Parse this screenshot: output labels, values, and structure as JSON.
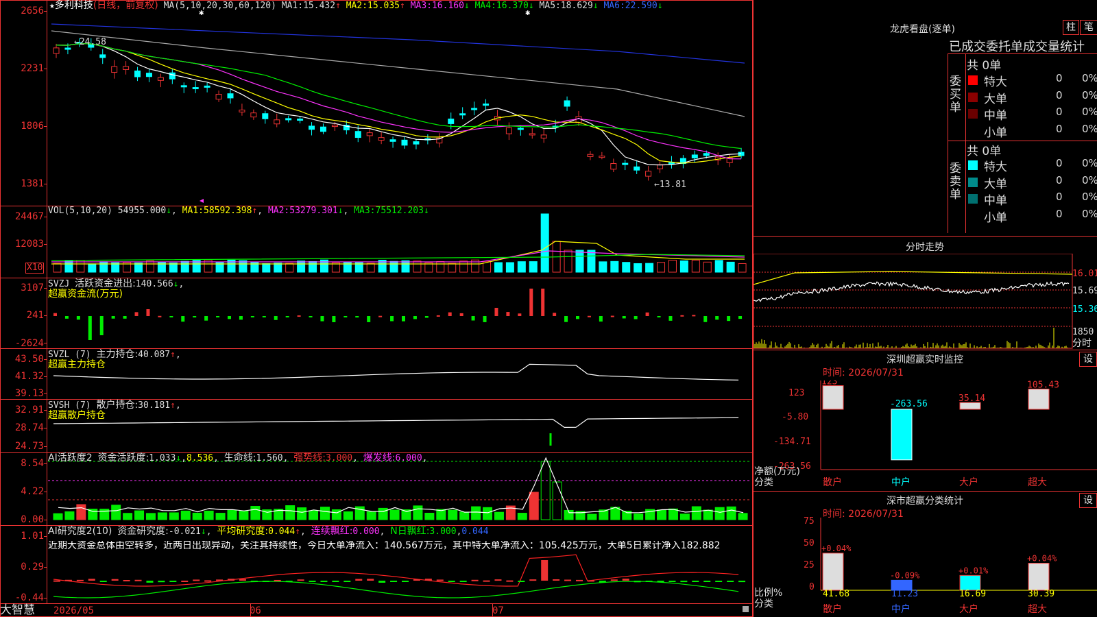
{
  "colors": {
    "up": "#ff2222",
    "down": "#00ffff",
    "green": "#00ee00",
    "yellow": "#ffff00",
    "magenta": "#ff33ff",
    "grid": "#cc2222",
    "white": "#ffffff"
  },
  "main": {
    "title_star": "★",
    "stock_name": "多利科技",
    "period": "(日线，前复权)",
    "ma_spec": "MA(5,10,20,30,60,120)",
    "ma": [
      {
        "label": "MA1:",
        "value": "15.432",
        "arrow": "↑"
      },
      {
        "label": "MA2:",
        "value": "15.035",
        "arrow": "↑"
      },
      {
        "label": "MA3:",
        "value": "16.160",
        "arrow": "↓"
      },
      {
        "label": "MA4:",
        "value": "16.370",
        "arrow": "↓"
      },
      {
        "label": "MA5:",
        "value": "18.629",
        "arrow": "↓"
      },
      {
        "label": "MA6:",
        "value": "22.590",
        "arrow": "↓"
      }
    ],
    "y_ticks": [
      "2656",
      "2231",
      "1806",
      "1381"
    ],
    "hi_label": "24.58",
    "lo_label": "13.81",
    "hi_arrow": "←",
    "lo_arrow": "←"
  },
  "vol": {
    "title": "VOL(5,10,20)",
    "value": "54955.000",
    "arrow": "↓",
    "ma": [
      {
        "label": "MA1:",
        "value": "58592.398",
        "arrow": "↑"
      },
      {
        "label": "MA2:",
        "value": "53279.301",
        "arrow": "↓"
      },
      {
        "label": "MA3:",
        "value": "75512.203",
        "arrow": "↓"
      }
    ],
    "y_ticks": [
      "24467",
      "12083"
    ],
    "unit": "X10"
  },
  "svzj": {
    "title": "SVZJ",
    "label": "活跃资金进出:",
    "value": "140.566",
    "arrow": "↓",
    "sub": "超赢资金流(万元)",
    "y_ticks": [
      "3107",
      "241",
      "-2624"
    ]
  },
  "svzl": {
    "title": "SVZL (7)",
    "label": "主力持仓:",
    "value": "40.087",
    "arrow": "↑",
    "sub": "超赢主力持仓",
    "y_ticks": [
      "43.50",
      "41.32",
      "39.13"
    ]
  },
  "svsh": {
    "title": "SVSH (7)",
    "label": "散户持仓:",
    "value": "30.181",
    "arrow": "↑",
    "sub": "超赢散户持仓",
    "y_ticks": [
      "32.91",
      "28.74",
      "24.73"
    ]
  },
  "ai1": {
    "title": "AI活跃度2",
    "label": "资金活跃度:",
    "value": "1.033",
    "arrow": "↓",
    "v2": "8.536",
    "line_label": "生命线:",
    "line_value": "1.560",
    "strong_label": "强势线:",
    "strong_value": "3.000",
    "burst_label": "爆发线:",
    "burst_value": "6.000",
    "y_ticks": [
      "8.54",
      "4.22",
      "0.00"
    ]
  },
  "ai2": {
    "title": "AI研究度2(10)",
    "label": "资金研究度:",
    "value": "-0.021",
    "arrow": "↓",
    "avg_label": "平均研究度:",
    "avg_value": "0.044",
    "cont_label": "连续飘红:",
    "cont_value": "0.000",
    "n_label": "N日飘红:",
    "n_value": "3.000",
    "extra": "0.044",
    "y_ticks": [
      "1.01",
      "0.29",
      "-0.44"
    ],
    "commentary": "近期大资金总体由空转多，近两日出现异动，关注其持续性，今日大单净流入：140.567万元，其中特大单净流入：105.425万元，大单5日累计净入182.882"
  },
  "xaxis": {
    "labels": [
      "2026/05",
      "06",
      "07"
    ]
  },
  "brand": "大智慧",
  "right": {
    "dragon_title": "龙虎看盘(逐单)",
    "btn_zhu": "柱",
    "btn_bi": "笔",
    "tbl_header": "已成交委托单成交量统计",
    "buy_label": "委买单",
    "sell_label": "委卖单",
    "buy_total": "共 0单",
    "sell_total": "共 0单",
    "rows": [
      {
        "name": "特大",
        "count": "0",
        "pct": "0%"
      },
      {
        "name": "大单",
        "count": "0",
        "pct": "0%"
      },
      {
        "name": "中单",
        "count": "0",
        "pct": "0%"
      },
      {
        "name": "小单",
        "count": "0",
        "pct": "0%"
      }
    ],
    "intraday_title": "分时走势",
    "intraday_y": [
      "16.01",
      "15.69",
      "15.36"
    ],
    "intraday_vol": "1850",
    "intraday_unit": "分时",
    "monitor_title": "深圳超赢实时监控",
    "monitor_btn": "设",
    "monitor_time": "时间: 2026/07/31",
    "monitor_y": [
      "123",
      "-5.80",
      "-134.71",
      "-263.56"
    ],
    "monitor_bars": [
      {
        "cat": "散户",
        "label": "123",
        "value": 123
      },
      {
        "cat": "中户",
        "label": "-263.56",
        "value": -263.56
      },
      {
        "cat": "大户",
        "label": "35.14",
        "value": 35.14
      },
      {
        "cat": "超大",
        "label": "105.43",
        "value": 105.43
      }
    ],
    "monitor_unit": "净额(万元)",
    "monitor_cat_label": "分类",
    "class_title": "深市超赢分类统计",
    "class_btn": "设",
    "class_time": "时间: 2026/07/31",
    "class_y": [
      "75",
      "50",
      "25",
      "0"
    ],
    "class_bars": [
      {
        "cat": "散户",
        "label": "+0.04%",
        "value": 41.68,
        "shown": "41.68"
      },
      {
        "cat": "中户",
        "label": "-0.09%",
        "value": 11.23,
        "shown": "11.23"
      },
      {
        "cat": "大户",
        "label": "+0.01%",
        "value": 16.69,
        "shown": "16.69"
      },
      {
        "cat": "超大",
        "label": "+0.04%",
        "value": 30.39,
        "shown": "30.39"
      }
    ],
    "class_unit": "比例%",
    "class_cat_label": "分类"
  }
}
